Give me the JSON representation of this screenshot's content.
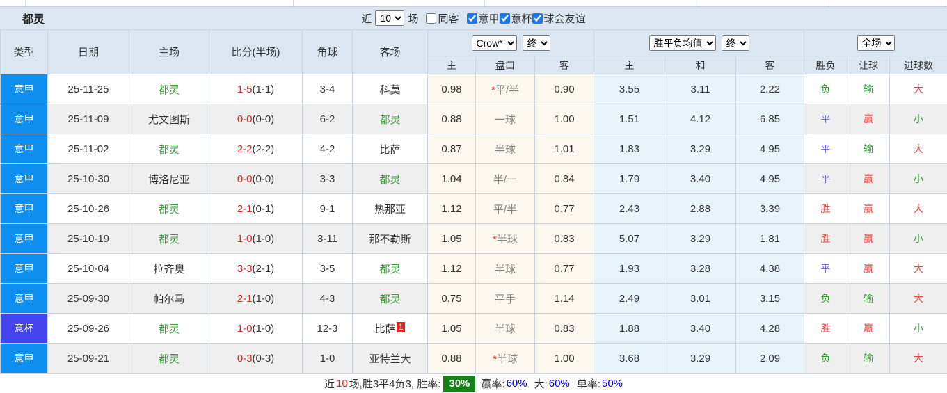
{
  "title": "都灵",
  "controls": {
    "recent_label": "近",
    "matches_count": "10",
    "matches_label": "场",
    "same_away_label": "同客",
    "same_away_checked": false,
    "filters": [
      {
        "label": "意甲",
        "checked": true
      },
      {
        "label": "意杯",
        "checked": true
      },
      {
        "label": "球会友谊",
        "checked": true
      }
    ]
  },
  "table": {
    "headers": {
      "type": "类型",
      "date": "日期",
      "home": "主场",
      "score": "比分(半场)",
      "corner": "角球",
      "away": "客场",
      "odds_home": "主",
      "odds_handicap": "盘口",
      "odds_away": "客",
      "avg_home": "主",
      "avg_draw": "和",
      "avg_away": "客",
      "result": "胜负",
      "handicap_result": "让球",
      "goals": "进球数"
    },
    "dropdowns": {
      "bookmaker": "Crow*",
      "odds_time": "终",
      "avg_type": "胜平负均值",
      "avg_time": "终",
      "scope": "全场"
    },
    "star_glyph": "*",
    "rows": [
      {
        "type": "意甲",
        "type_class": "league",
        "date": "25-11-25",
        "home": "都灵",
        "home_hl": true,
        "score": "1-5",
        "half": "(1-1)",
        "corner": "3-4",
        "away": "科莫",
        "away_hl": false,
        "odds_home": "0.98",
        "handicap_star": true,
        "handicap": "平/半",
        "odds_away": "0.90",
        "avg_home": "3.55",
        "avg_draw": "3.11",
        "avg_away": "2.22",
        "result": "负",
        "handicap_result": "输",
        "goals": "大"
      },
      {
        "type": "意甲",
        "type_class": "league",
        "date": "25-11-09",
        "home": "尤文图斯",
        "home_hl": false,
        "score": "0-0",
        "half": "(0-0)",
        "corner": "6-2",
        "away": "都灵",
        "away_hl": true,
        "odds_home": "0.88",
        "handicap_star": false,
        "handicap": "一球",
        "odds_away": "1.00",
        "avg_home": "1.51",
        "avg_draw": "4.12",
        "avg_away": "6.85",
        "result": "平",
        "handicap_result": "赢",
        "goals": "小"
      },
      {
        "type": "意甲",
        "type_class": "league",
        "date": "25-11-02",
        "home": "都灵",
        "home_hl": true,
        "score": "2-2",
        "half": "(2-2)",
        "corner": "4-2",
        "away": "比萨",
        "away_hl": false,
        "odds_home": "0.87",
        "handicap_star": false,
        "handicap": "半球",
        "odds_away": "1.01",
        "avg_home": "1.83",
        "avg_draw": "3.29",
        "avg_away": "4.95",
        "result": "平",
        "handicap_result": "输",
        "goals": "大"
      },
      {
        "type": "意甲",
        "type_class": "league",
        "date": "25-10-30",
        "home": "博洛尼亚",
        "home_hl": false,
        "score": "0-0",
        "half": "(0-0)",
        "corner": "3-3",
        "away": "都灵",
        "away_hl": true,
        "odds_home": "1.04",
        "handicap_star": false,
        "handicap": "半/一",
        "odds_away": "0.84",
        "avg_home": "1.79",
        "avg_draw": "3.40",
        "avg_away": "4.95",
        "result": "平",
        "handicap_result": "赢",
        "goals": "小"
      },
      {
        "type": "意甲",
        "type_class": "league",
        "date": "25-10-26",
        "home": "都灵",
        "home_hl": true,
        "score": "2-1",
        "half": "(0-1)",
        "corner": "9-1",
        "away": "热那亚",
        "away_hl": false,
        "odds_home": "1.12",
        "handicap_star": false,
        "handicap": "平/半",
        "odds_away": "0.77",
        "avg_home": "2.43",
        "avg_draw": "2.88",
        "avg_away": "3.39",
        "result": "胜",
        "handicap_result": "赢",
        "goals": "大"
      },
      {
        "type": "意甲",
        "type_class": "league",
        "date": "25-10-19",
        "home": "都灵",
        "home_hl": true,
        "score": "1-0",
        "half": "(1-0)",
        "corner": "3-11",
        "away": "那不勒斯",
        "away_hl": false,
        "odds_home": "1.05",
        "handicap_star": true,
        "handicap": "半球",
        "odds_away": "0.83",
        "avg_home": "5.07",
        "avg_draw": "3.29",
        "avg_away": "1.81",
        "result": "胜",
        "handicap_result": "赢",
        "goals": "小"
      },
      {
        "type": "意甲",
        "type_class": "league",
        "date": "25-10-04",
        "home": "拉齐奥",
        "home_hl": false,
        "score": "3-3",
        "half": "(2-1)",
        "corner": "3-5",
        "away": "都灵",
        "away_hl": true,
        "odds_home": "1.12",
        "handicap_star": false,
        "handicap": "半球",
        "odds_away": "0.77",
        "avg_home": "1.93",
        "avg_draw": "3.28",
        "avg_away": "4.38",
        "result": "平",
        "handicap_result": "赢",
        "goals": "大"
      },
      {
        "type": "意甲",
        "type_class": "league",
        "date": "25-09-30",
        "home": "帕尔马",
        "home_hl": false,
        "score": "2-1",
        "half": "(1-0)",
        "corner": "4-3",
        "away": "都灵",
        "away_hl": true,
        "odds_home": "0.75",
        "handicap_star": false,
        "handicap": "平手",
        "odds_away": "1.14",
        "avg_home": "2.49",
        "avg_draw": "3.01",
        "avg_away": "3.15",
        "result": "负",
        "handicap_result": "输",
        "goals": "大"
      },
      {
        "type": "意杯",
        "type_class": "cup",
        "date": "25-09-26",
        "home": "都灵",
        "home_hl": true,
        "score": "1-0",
        "half": "(1-0)",
        "corner": "12-3",
        "away": "比萨",
        "away_hl": false,
        "away_sup": "1",
        "odds_home": "1.05",
        "handicap_star": false,
        "handicap": "半球",
        "odds_away": "0.83",
        "avg_home": "1.88",
        "avg_draw": "3.40",
        "avg_away": "4.28",
        "result": "胜",
        "handicap_result": "赢",
        "goals": "小"
      },
      {
        "type": "意甲",
        "type_class": "league",
        "date": "25-09-21",
        "home": "都灵",
        "home_hl": true,
        "score": "0-3",
        "half": "(0-3)",
        "corner": "1-0",
        "away": "亚特兰大",
        "away_hl": false,
        "odds_home": "0.88",
        "handicap_star": true,
        "handicap": "半球",
        "odds_away": "1.00",
        "avg_home": "3.68",
        "avg_draw": "3.29",
        "avg_away": "2.09",
        "result": "负",
        "handicap_result": "输",
        "goals": "大"
      }
    ]
  },
  "result_colors": {
    "胜": "red",
    "平": "blue",
    "负": "green",
    "赢": "red",
    "输": "green",
    "大": "red",
    "小": "green"
  },
  "footer": {
    "seg_recent": "近",
    "seg_count": "10",
    "seg_stats": "场,胜3平4负3, 胜率:",
    "win_rate": "30%",
    "win_label": "赢率:",
    "win_value": "60%",
    "big_label": "大:",
    "big_value": "60%",
    "single_label": "单率:",
    "single_value": "50%"
  },
  "colors": {
    "league_badge": "#0e8ff0",
    "cup_badge": "#4444ee",
    "team_highlight": "#3c9a3c",
    "score_red": "#e52222",
    "result_red": "#e84040",
    "result_green": "#2f9b2f",
    "result_blue": "#7070f0",
    "handicap_gray": "#828282",
    "rate_box_bg": "#188018",
    "rate_value_blue": "#0000dd"
  }
}
